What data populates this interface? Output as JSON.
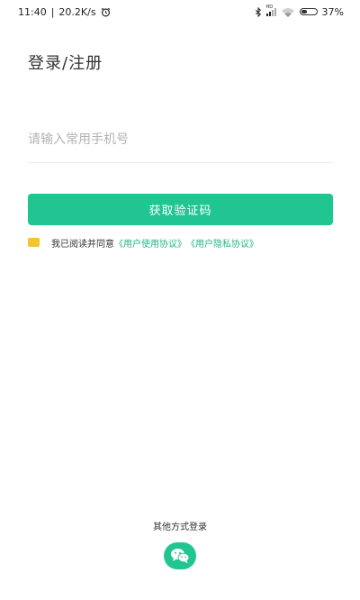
{
  "status_bar": {
    "time": "11:40",
    "separator": "|",
    "net_speed": "20.2K/s",
    "hd_label": "HD",
    "battery": "37%",
    "battery_level": 0.37
  },
  "page": {
    "title": "登录/注册"
  },
  "form": {
    "phone_placeholder": "请输入常用手机号",
    "phone_value": "",
    "get_code_label": "获取验证码"
  },
  "agreement": {
    "prefix": "我已阅读并同意",
    "user_agreement": "《用户使用协议》",
    "privacy_agreement": "《用户隐私协议》"
  },
  "other_login": {
    "label": "其他方式登录",
    "wechat_icon": "wechat-icon"
  },
  "colors": {
    "accent": "#20c591",
    "link": "#20b487",
    "checkbox": "#f4c530"
  }
}
